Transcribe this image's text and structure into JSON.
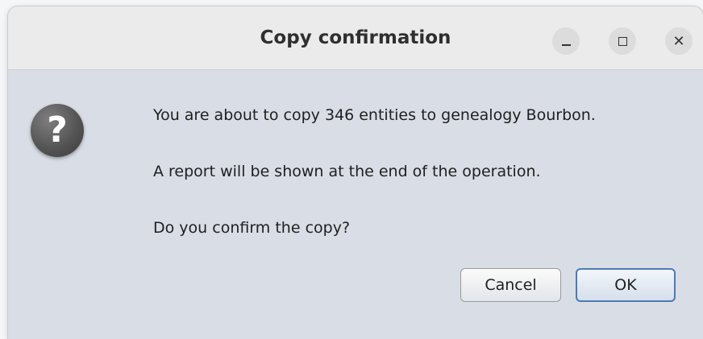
{
  "window": {
    "title": "Copy confirmation",
    "controls": {
      "minimize": "minimize-icon",
      "maximize": "maximize-icon",
      "close_glyph": "✕"
    }
  },
  "dialog": {
    "icon": "question-icon",
    "icon_glyph": "?",
    "message_line1": "You are about to copy 346 entities to genealogy Bourbon.",
    "message_line2": "A report will be shown at the end of the operation.",
    "message_line3": "Do you confirm the copy?",
    "cancel_label": "Cancel",
    "ok_label": "OK"
  },
  "colors": {
    "dialog_background": "#d9dde6",
    "titlebar_background": "#ebebeb",
    "default_button_border": "#4d7ab3"
  }
}
